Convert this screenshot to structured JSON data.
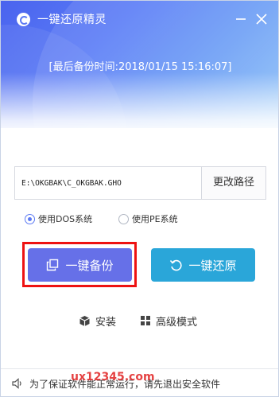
{
  "window": {
    "title": "一键还原精灵",
    "last_backup": "[最后备份时间:2018/01/15 15:16:07]"
  },
  "path": {
    "value": "E:\\OKGBAK\\C_OKGBAK.GHO",
    "change_button": "更改路径"
  },
  "system_options": [
    {
      "label": "使用DOS系统",
      "checked": true
    },
    {
      "label": "使用PE系统",
      "checked": false
    }
  ],
  "actions": {
    "backup_label": "一键备份",
    "restore_label": "一键还原"
  },
  "links": {
    "install_label": "安装",
    "advanced_label": "高级模式"
  },
  "footer": {
    "notice": "为了保证软件能正常运行，请先退出安全软件"
  },
  "watermark": "ux12345.com",
  "colors": {
    "accent": "#5b79f3",
    "backup_button": "#6670e8",
    "restore_button": "#2aa6d9",
    "highlight": "#ee1212"
  }
}
